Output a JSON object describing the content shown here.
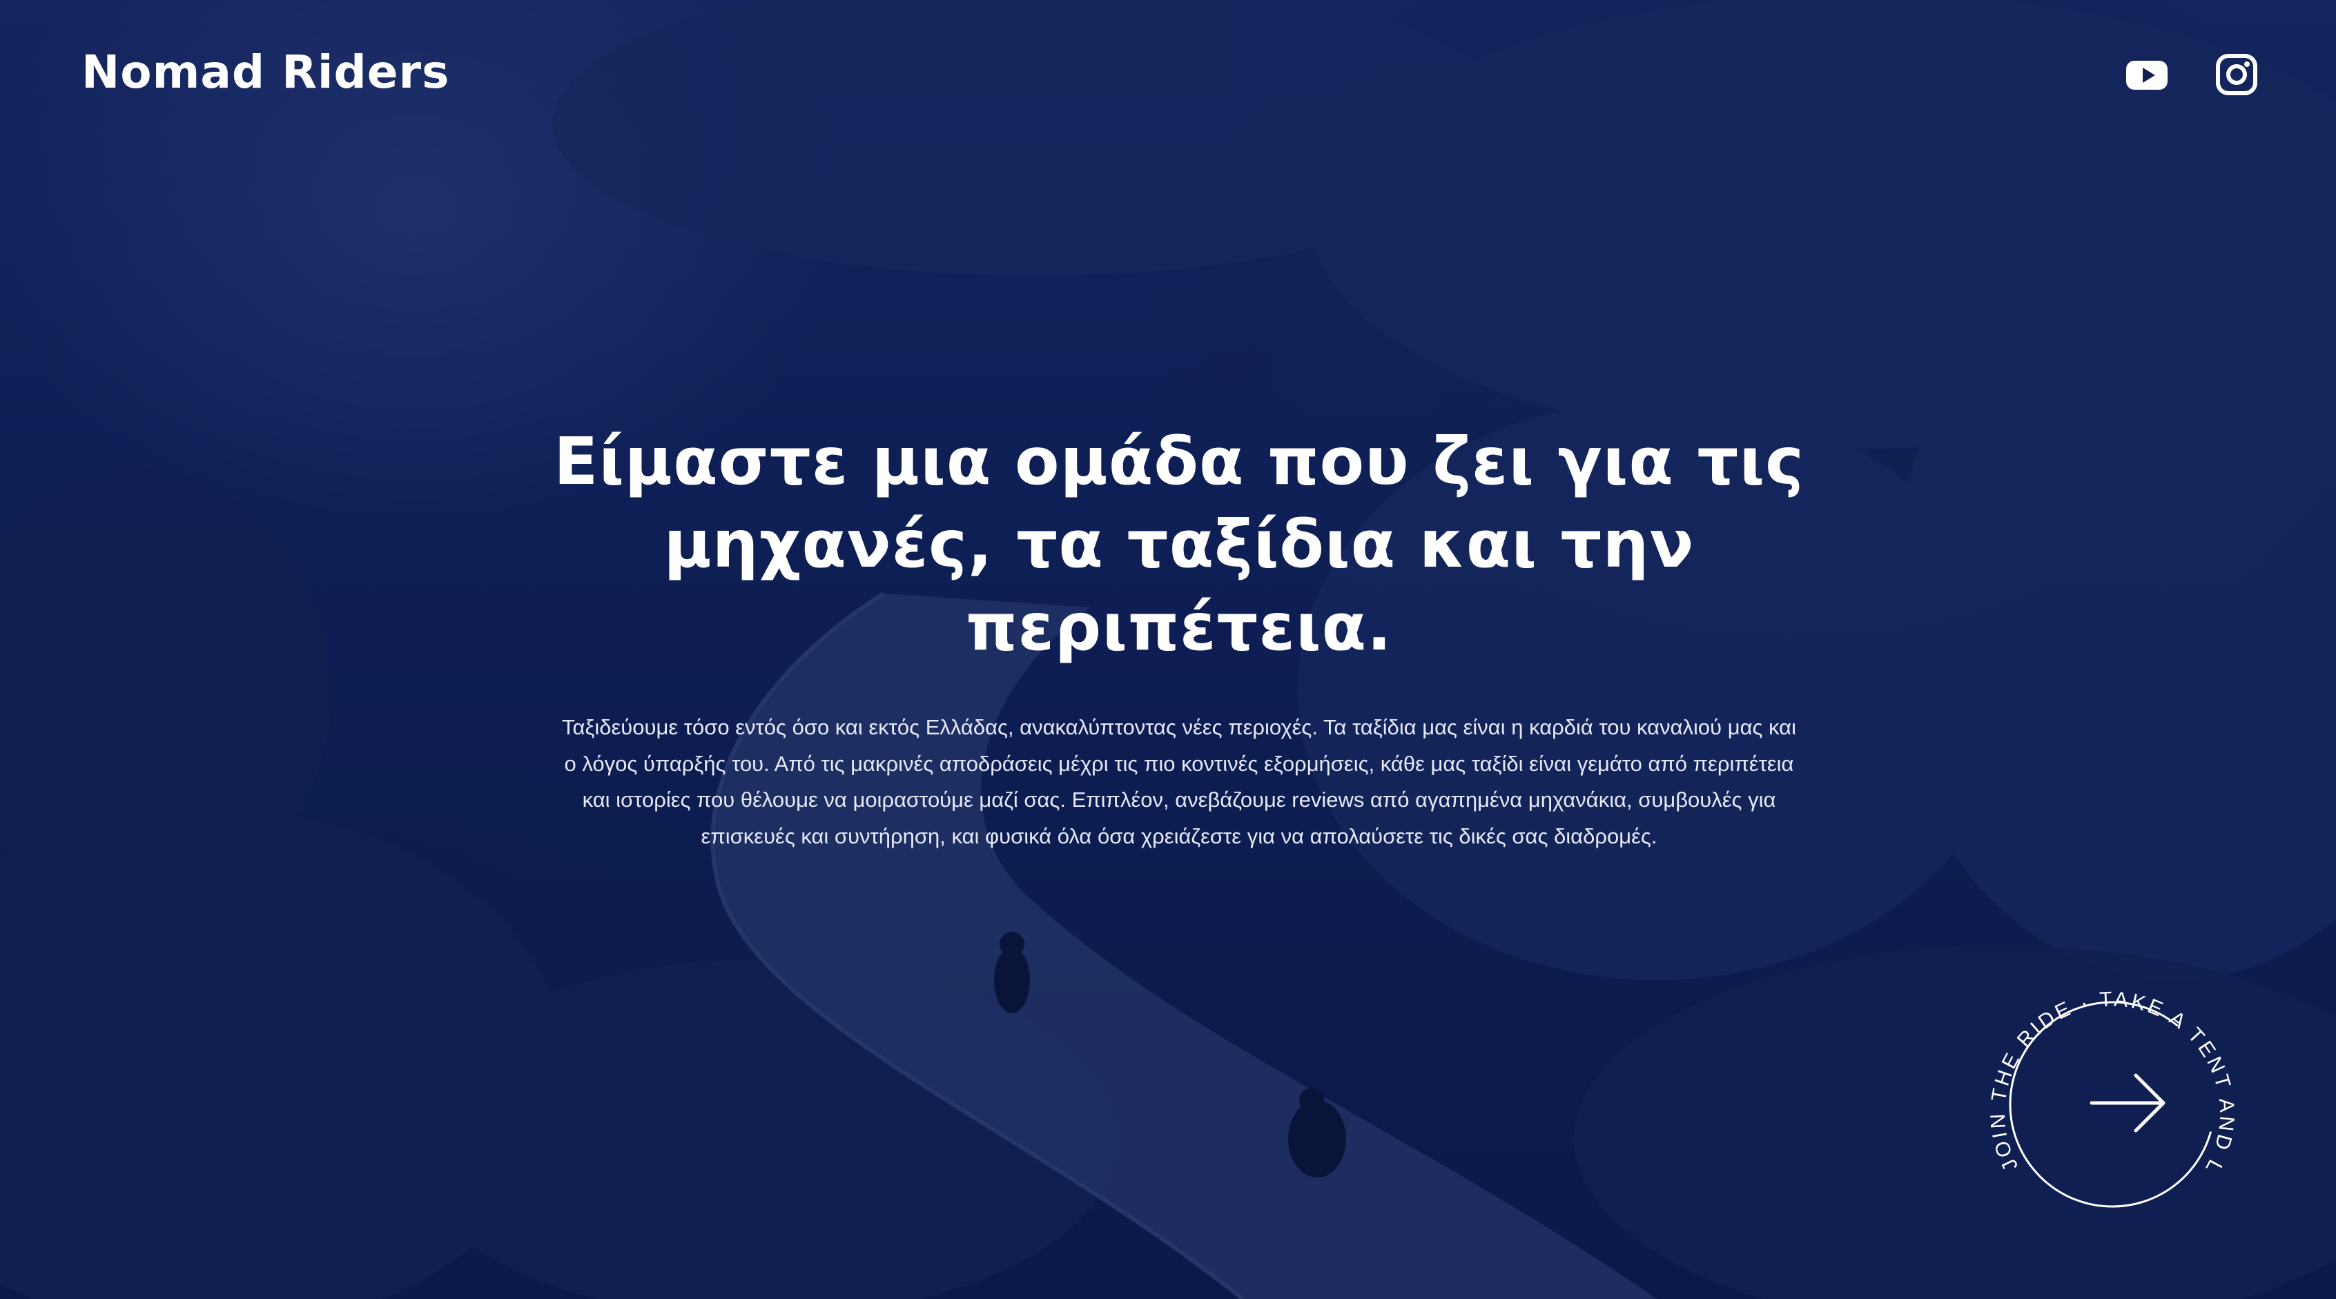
{
  "brand": {
    "name": "Nomad Riders"
  },
  "social": {
    "youtube_label": "YouTube",
    "instagram_label": "Instagram"
  },
  "hero": {
    "title": "Είμαστε μια ομάδα που ζει για τις μηχανές, τα ταξίδια και την περιπέτεια.",
    "description": "Ταξιδεύουμε τόσο εντός όσο και εκτός Ελλάδας, ανακαλύπτοντας νέες περιοχές. Τα ταξίδια μας είναι η καρδιά του καναλιού μας και ο λόγος ύπαρξής του. Από τις μακρινές αποδράσεις μέχρι τις πιο κοντινές εξορμήσεις, κάθε μας ταξίδι είναι γεμάτο από περιπέτεια και ιστορίες που θέλουμε να μοιραστούμε μαζί σας. Επιπλέον, ανεβάζουμε reviews από αγαπημένα μηχανάκια, συμβουλές για επισκευές και συντήρηση, και φυσικά όλα όσα χρειάζεστε για να απολαύσετε τις δικές σας διαδρομές."
  },
  "cta": {
    "circular_text": "JOIN THE RIDE · TAKE A TENT AND LEAVE"
  },
  "colors": {
    "overlay": "#0b1a4a",
    "text": "#ffffff"
  }
}
